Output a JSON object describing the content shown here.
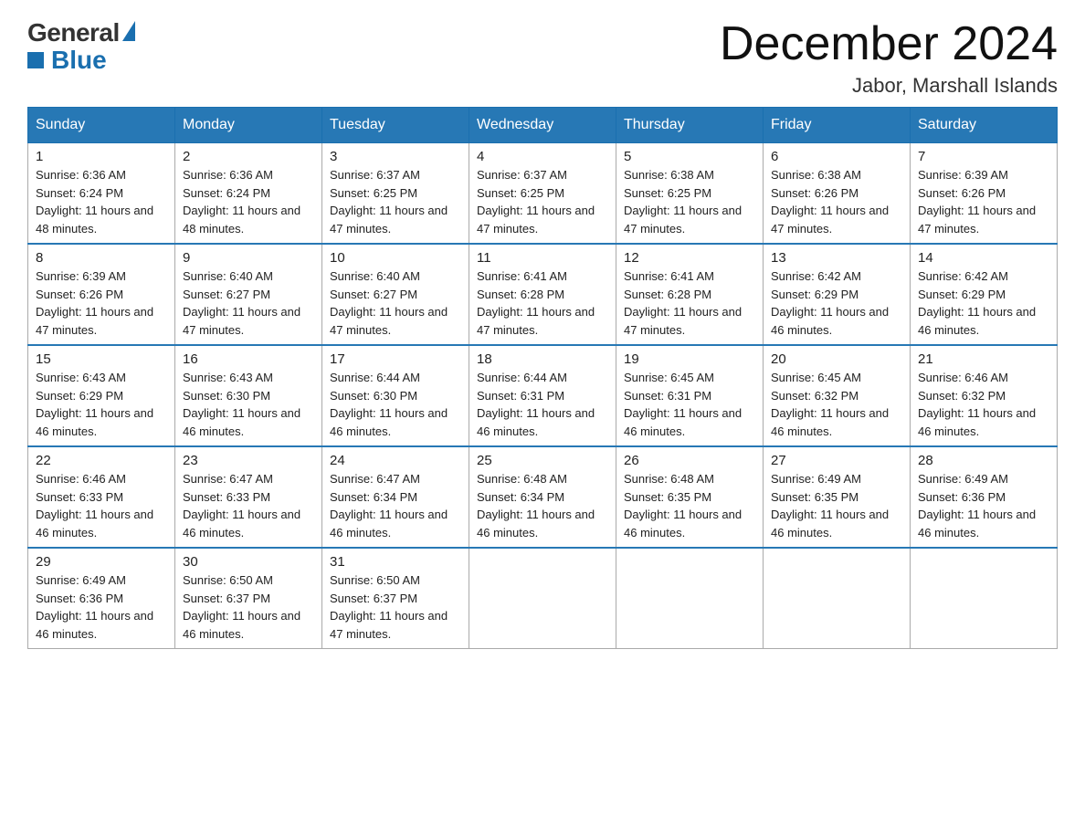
{
  "logo": {
    "text_general": "General",
    "text_blue": "Blue"
  },
  "title": "December 2024",
  "subtitle": "Jabor, Marshall Islands",
  "headers": [
    "Sunday",
    "Monday",
    "Tuesday",
    "Wednesday",
    "Thursday",
    "Friday",
    "Saturday"
  ],
  "weeks": [
    [
      {
        "day": "1",
        "sunrise": "6:36 AM",
        "sunset": "6:24 PM",
        "daylight": "11 hours and 48 minutes."
      },
      {
        "day": "2",
        "sunrise": "6:36 AM",
        "sunset": "6:24 PM",
        "daylight": "11 hours and 48 minutes."
      },
      {
        "day": "3",
        "sunrise": "6:37 AM",
        "sunset": "6:25 PM",
        "daylight": "11 hours and 47 minutes."
      },
      {
        "day": "4",
        "sunrise": "6:37 AM",
        "sunset": "6:25 PM",
        "daylight": "11 hours and 47 minutes."
      },
      {
        "day": "5",
        "sunrise": "6:38 AM",
        "sunset": "6:25 PM",
        "daylight": "11 hours and 47 minutes."
      },
      {
        "day": "6",
        "sunrise": "6:38 AM",
        "sunset": "6:26 PM",
        "daylight": "11 hours and 47 minutes."
      },
      {
        "day": "7",
        "sunrise": "6:39 AM",
        "sunset": "6:26 PM",
        "daylight": "11 hours and 47 minutes."
      }
    ],
    [
      {
        "day": "8",
        "sunrise": "6:39 AM",
        "sunset": "6:26 PM",
        "daylight": "11 hours and 47 minutes."
      },
      {
        "day": "9",
        "sunrise": "6:40 AM",
        "sunset": "6:27 PM",
        "daylight": "11 hours and 47 minutes."
      },
      {
        "day": "10",
        "sunrise": "6:40 AM",
        "sunset": "6:27 PM",
        "daylight": "11 hours and 47 minutes."
      },
      {
        "day": "11",
        "sunrise": "6:41 AM",
        "sunset": "6:28 PM",
        "daylight": "11 hours and 47 minutes."
      },
      {
        "day": "12",
        "sunrise": "6:41 AM",
        "sunset": "6:28 PM",
        "daylight": "11 hours and 47 minutes."
      },
      {
        "day": "13",
        "sunrise": "6:42 AM",
        "sunset": "6:29 PM",
        "daylight": "11 hours and 46 minutes."
      },
      {
        "day": "14",
        "sunrise": "6:42 AM",
        "sunset": "6:29 PM",
        "daylight": "11 hours and 46 minutes."
      }
    ],
    [
      {
        "day": "15",
        "sunrise": "6:43 AM",
        "sunset": "6:29 PM",
        "daylight": "11 hours and 46 minutes."
      },
      {
        "day": "16",
        "sunrise": "6:43 AM",
        "sunset": "6:30 PM",
        "daylight": "11 hours and 46 minutes."
      },
      {
        "day": "17",
        "sunrise": "6:44 AM",
        "sunset": "6:30 PM",
        "daylight": "11 hours and 46 minutes."
      },
      {
        "day": "18",
        "sunrise": "6:44 AM",
        "sunset": "6:31 PM",
        "daylight": "11 hours and 46 minutes."
      },
      {
        "day": "19",
        "sunrise": "6:45 AM",
        "sunset": "6:31 PM",
        "daylight": "11 hours and 46 minutes."
      },
      {
        "day": "20",
        "sunrise": "6:45 AM",
        "sunset": "6:32 PM",
        "daylight": "11 hours and 46 minutes."
      },
      {
        "day": "21",
        "sunrise": "6:46 AM",
        "sunset": "6:32 PM",
        "daylight": "11 hours and 46 minutes."
      }
    ],
    [
      {
        "day": "22",
        "sunrise": "6:46 AM",
        "sunset": "6:33 PM",
        "daylight": "11 hours and 46 minutes."
      },
      {
        "day": "23",
        "sunrise": "6:47 AM",
        "sunset": "6:33 PM",
        "daylight": "11 hours and 46 minutes."
      },
      {
        "day": "24",
        "sunrise": "6:47 AM",
        "sunset": "6:34 PM",
        "daylight": "11 hours and 46 minutes."
      },
      {
        "day": "25",
        "sunrise": "6:48 AM",
        "sunset": "6:34 PM",
        "daylight": "11 hours and 46 minutes."
      },
      {
        "day": "26",
        "sunrise": "6:48 AM",
        "sunset": "6:35 PM",
        "daylight": "11 hours and 46 minutes."
      },
      {
        "day": "27",
        "sunrise": "6:49 AM",
        "sunset": "6:35 PM",
        "daylight": "11 hours and 46 minutes."
      },
      {
        "day": "28",
        "sunrise": "6:49 AM",
        "sunset": "6:36 PM",
        "daylight": "11 hours and 46 minutes."
      }
    ],
    [
      {
        "day": "29",
        "sunrise": "6:49 AM",
        "sunset": "6:36 PM",
        "daylight": "11 hours and 46 minutes."
      },
      {
        "day": "30",
        "sunrise": "6:50 AM",
        "sunset": "6:37 PM",
        "daylight": "11 hours and 46 minutes."
      },
      {
        "day": "31",
        "sunrise": "6:50 AM",
        "sunset": "6:37 PM",
        "daylight": "11 hours and 47 minutes."
      },
      null,
      null,
      null,
      null
    ]
  ]
}
